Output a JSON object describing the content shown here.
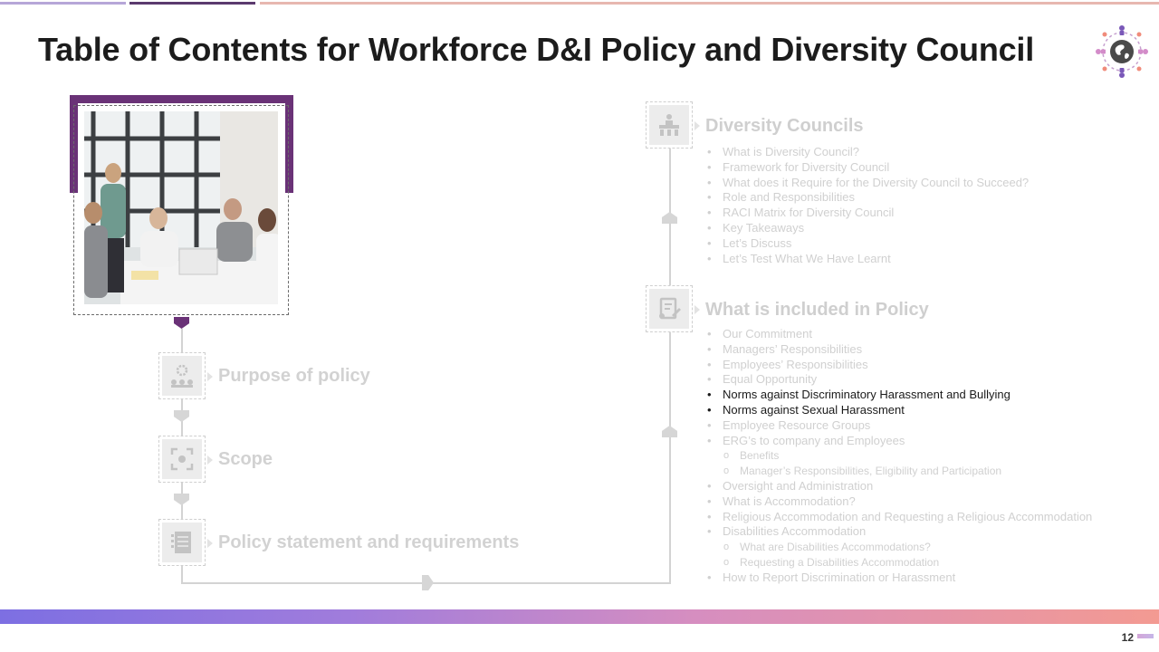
{
  "slide": {
    "title": "Table of Contents for Workforce D&I Policy and Diversity Council",
    "page_number": "12"
  },
  "left_sections": [
    {
      "label": "Purpose of policy",
      "icon": "gear-team-icon"
    },
    {
      "label": "Scope",
      "icon": "focus-icon"
    },
    {
      "label": "Policy statement and requirements",
      "icon": "document-list-icon"
    }
  ],
  "diversity_councils": {
    "heading": "Diversity Councils",
    "icon": "meeting-table-icon",
    "items": [
      "What is Diversity Council?",
      "Framework for Diversity Council",
      "What does it Require for the Diversity Council to Succeed?",
      "Role and Responsibilities",
      "RACI Matrix for Diversity Council",
      "Key Takeaways",
      "Let’s Discuss",
      "Let’s Test What We Have Learnt"
    ]
  },
  "policy": {
    "heading": "What is included in Policy",
    "icon": "document-edit-icon",
    "items": [
      {
        "text": "Our Commitment",
        "level": 1,
        "active": false
      },
      {
        "text": "Managers’ Responsibilities",
        "level": 1,
        "active": false
      },
      {
        "text": "Employees’ Responsibilities",
        "level": 1,
        "active": false
      },
      {
        "text": "Equal Opportunity",
        "level": 1,
        "active": false
      },
      {
        "text": "Norms against Discriminatory Harassment and Bullying",
        "level": 1,
        "active": true
      },
      {
        "text": "Norms against Sexual Harassment",
        "level": 1,
        "active": true
      },
      {
        "text": "Employee Resource Groups",
        "level": 1,
        "active": false
      },
      {
        "text": "ERG’s to company and Employees",
        "level": 1,
        "active": false
      },
      {
        "text": "Benefits",
        "level": 2,
        "active": false
      },
      {
        "text": "Manager’s Responsibilities, Eligibility and Participation",
        "level": 2,
        "active": false
      },
      {
        "text": "Oversight and Administration",
        "level": 1,
        "active": false
      },
      {
        "text": "What is Accommodation?",
        "level": 1,
        "active": false
      },
      {
        "text": "Religious Accommodation and Requesting a Religious Accommodation",
        "level": 1,
        "active": false
      },
      {
        "text": "Disabilities Accommodation",
        "level": 1,
        "active": false
      },
      {
        "text": "What are Disabilities Accommodations?",
        "level": 2,
        "active": false
      },
      {
        "text": "Requesting a Disabilities Accommodation",
        "level": 2,
        "active": false
      },
      {
        "text": "How to Report Discrimination or Harassment",
        "level": 1,
        "active": false
      }
    ]
  },
  "colors": {
    "accent_purple": "#6a3277",
    "inactive_text": "#d0d0d0",
    "active_text": "#1a1a1a"
  }
}
